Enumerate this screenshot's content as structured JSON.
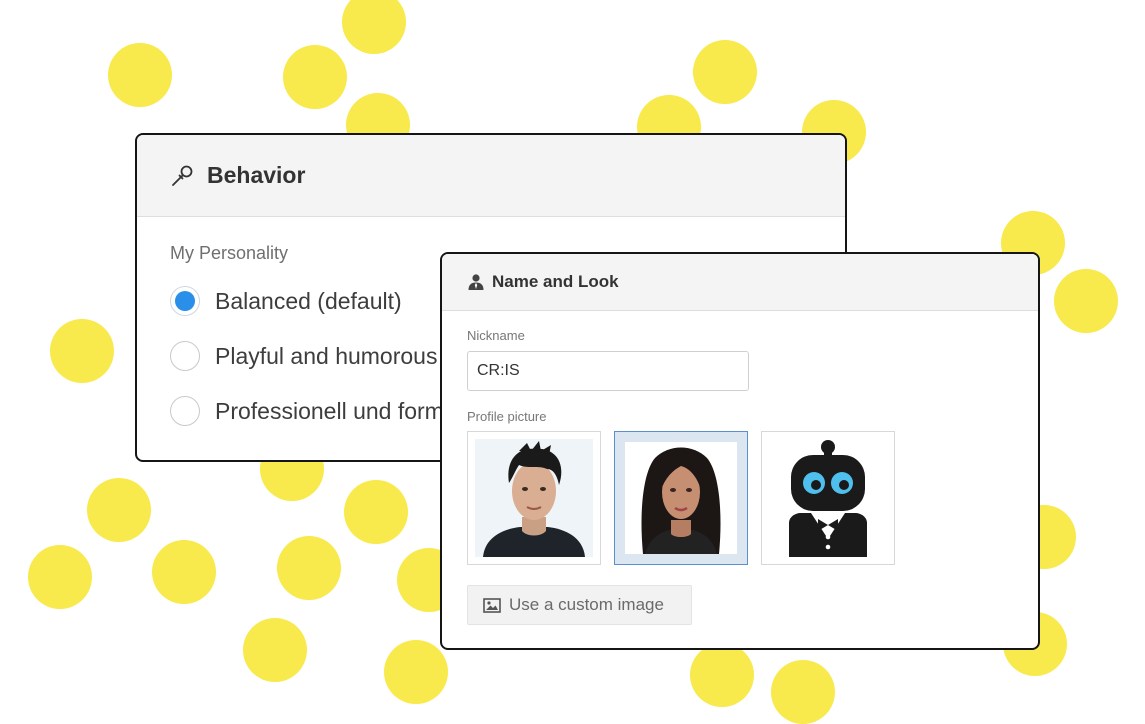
{
  "behavior_panel": {
    "title": "Behavior",
    "title_icon": "microphone-icon",
    "section_label": "My Personality",
    "options": [
      {
        "label": "Balanced (default)",
        "selected": true
      },
      {
        "label": "Playful and humorous",
        "selected": false
      },
      {
        "label": "Professionell und formell",
        "selected": false
      }
    ]
  },
  "name_look_panel": {
    "title": "Name and Look",
    "title_icon": "person-icon",
    "nickname_label": "Nickname",
    "nickname_value": "CR:IS",
    "profile_picture_label": "Profile picture",
    "avatars": [
      {
        "name": "male-avatar",
        "selected": false
      },
      {
        "name": "female-avatar",
        "selected": true
      },
      {
        "name": "robot-avatar",
        "selected": false
      }
    ],
    "custom_image_button": "Use a custom image",
    "custom_image_icon": "image-icon"
  },
  "colors": {
    "dot": "#f8e94c",
    "radio_selected": "#2a8fe8",
    "card_border": "#151515",
    "selected_avatar_bg": "#dbe6f1"
  }
}
